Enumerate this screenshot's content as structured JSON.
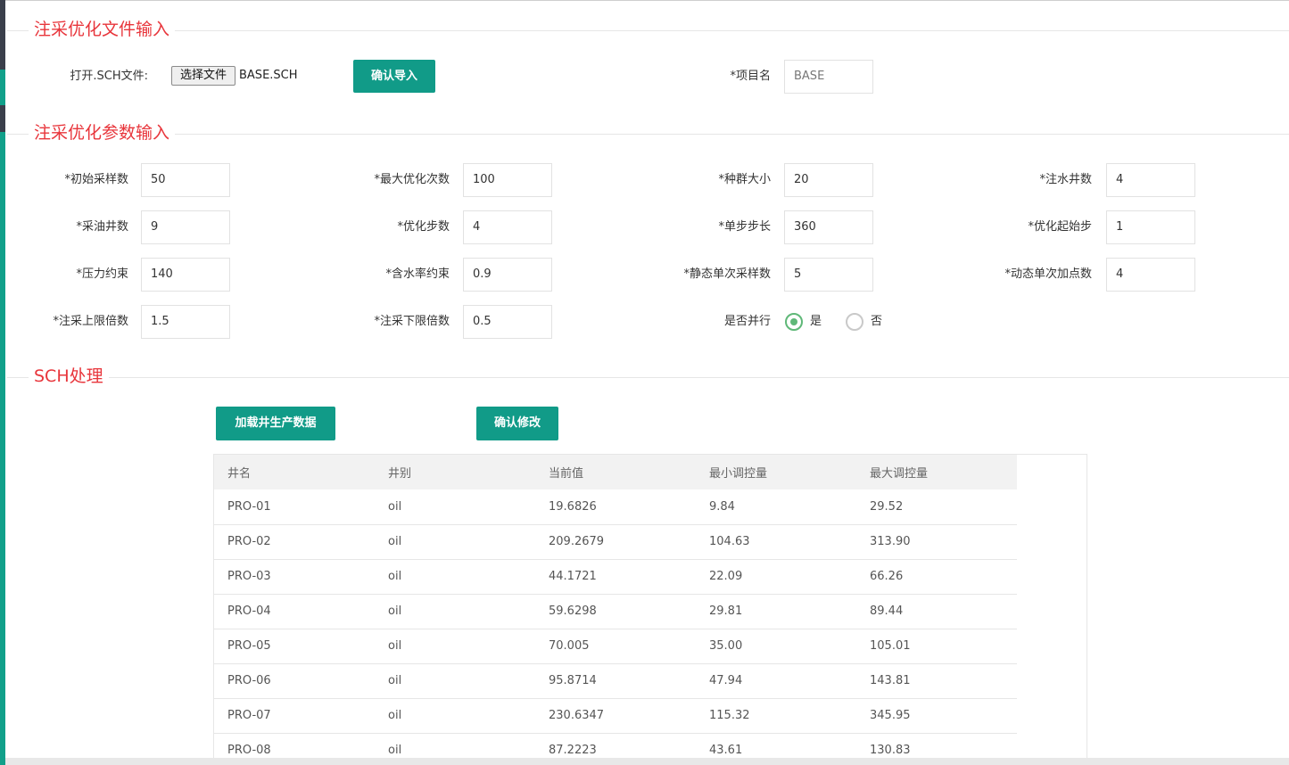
{
  "section1": {
    "title": "注采优化文件输入",
    "open_label": "打开.SCH文件:",
    "file_button": "选择文件",
    "file_name": "BASE.SCH",
    "import_button": "确认导入",
    "project_label": "*项目名",
    "project_placeholder": "BASE"
  },
  "section2": {
    "title": "注采优化参数输入",
    "fields": [
      {
        "label": "*初始采样数",
        "value": "50"
      },
      {
        "label": "*最大优化次数",
        "value": "100"
      },
      {
        "label": "*种群大小",
        "value": "20"
      },
      {
        "label": "*注水井数",
        "value": "4"
      },
      {
        "label": "*采油井数",
        "value": "9"
      },
      {
        "label": "*优化步数",
        "value": "4"
      },
      {
        "label": "*单步步长",
        "value": "360"
      },
      {
        "label": "*优化起始步",
        "value": "1"
      },
      {
        "label": "*压力约束",
        "value": "140"
      },
      {
        "label": "*含水率约束",
        "value": "0.9"
      },
      {
        "label": "*静态单次采样数",
        "value": "5"
      },
      {
        "label": "*动态单次加点数",
        "value": "4"
      },
      {
        "label": "*注采上限倍数",
        "value": "1.5"
      },
      {
        "label": "*注采下限倍数",
        "value": "0.5"
      }
    ],
    "parallel_label": "是否并行",
    "parallel_yes": "是",
    "parallel_no": "否",
    "parallel_selected": "是"
  },
  "section3": {
    "title": "SCH处理",
    "load_button": "加载井生产数据",
    "confirm_button": "确认修改",
    "table": {
      "headers": [
        "井名",
        "井别",
        "当前值",
        "最小调控量",
        "最大调控量"
      ],
      "rows": [
        [
          "PRO-01",
          "oil",
          "19.6826",
          "9.84",
          "29.52"
        ],
        [
          "PRO-02",
          "oil",
          "209.2679",
          "104.63",
          "313.90"
        ],
        [
          "PRO-03",
          "oil",
          "44.1721",
          "22.09",
          "66.26"
        ],
        [
          "PRO-04",
          "oil",
          "59.6298",
          "29.81",
          "89.44"
        ],
        [
          "PRO-05",
          "oil",
          "70.005",
          "35.00",
          "105.01"
        ],
        [
          "PRO-06",
          "oil",
          "95.8714",
          "47.94",
          "143.81"
        ],
        [
          "PRO-07",
          "oil",
          "230.6347",
          "115.32",
          "345.95"
        ],
        [
          "PRO-08",
          "oil",
          "87.2223",
          "43.61",
          "130.83"
        ]
      ]
    }
  },
  "colors": {
    "accent": "#119b88",
    "section_title": "#e8353b",
    "radio_checked": "#5fb878"
  }
}
